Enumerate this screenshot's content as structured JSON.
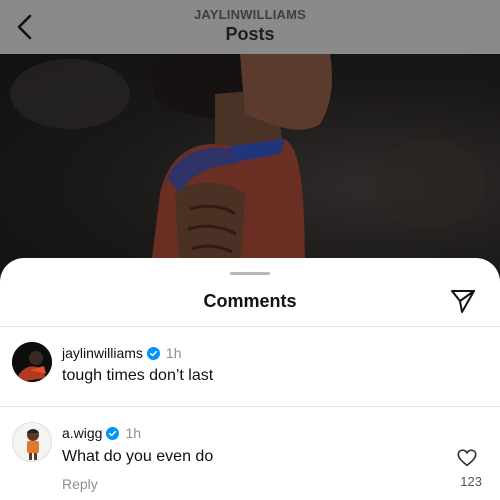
{
  "header": {
    "username": "JAYLINWILLIAMS",
    "title": "Posts",
    "back_icon": "chevron-left-icon"
  },
  "sheet": {
    "title": "Comments",
    "share_icon": "send-icon"
  },
  "comments": [
    {
      "username": "jaylinwilliams",
      "verified": true,
      "time": "1h",
      "text": "tough times don’t last"
    },
    {
      "username": "a.wigg",
      "verified": true,
      "time": "1h",
      "text": "What do you even do",
      "reply_label": "Reply",
      "like_count": "123"
    }
  ],
  "colors": {
    "verified_blue": "#0095f6",
    "header_bg": "#8a8a8a",
    "muted_text": "#8e8e8e"
  }
}
